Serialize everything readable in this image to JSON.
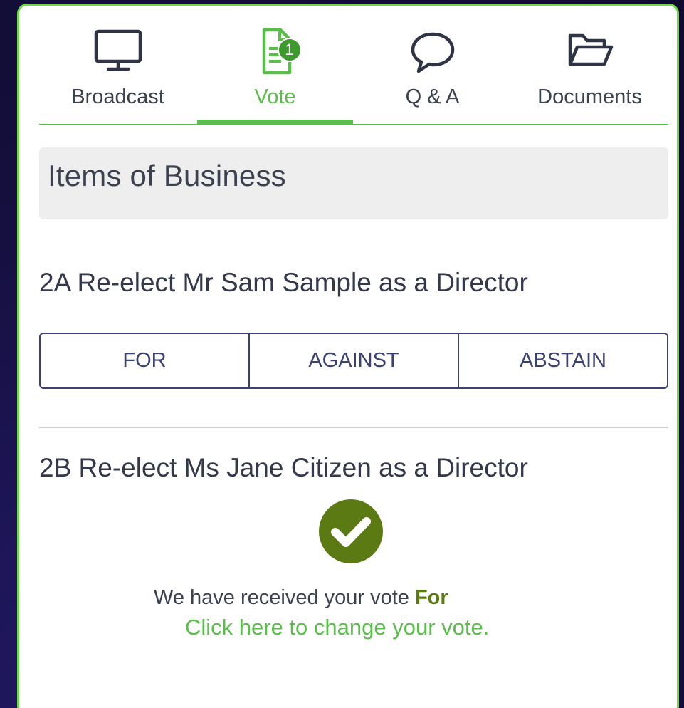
{
  "tabs": [
    {
      "label": "Broadcast",
      "icon": "monitor-icon",
      "active": false
    },
    {
      "label": "Vote",
      "icon": "document-icon",
      "active": true,
      "badge": "1"
    },
    {
      "label": "Q & A",
      "icon": "speech-bubble-icon",
      "active": false
    },
    {
      "label": "Documents",
      "icon": "folder-icon",
      "active": false
    }
  ],
  "header": {
    "title": "Items of Business"
  },
  "resolutions": [
    {
      "title": "2A Re-elect Mr Sam Sample as a Director",
      "options": [
        "FOR",
        "AGAINST",
        "ABSTAIN"
      ]
    },
    {
      "title": "2B Re-elect Ms Jane Citizen as a Director",
      "status_text": "We have received your vote",
      "vote_value": "For",
      "change_link": "Click here to change your vote."
    }
  ],
  "colors": {
    "accent": "#5bbd4c",
    "vote_value": "#5c7a14",
    "check_badge": "#5c7a14",
    "button_border": "#3b4170"
  }
}
